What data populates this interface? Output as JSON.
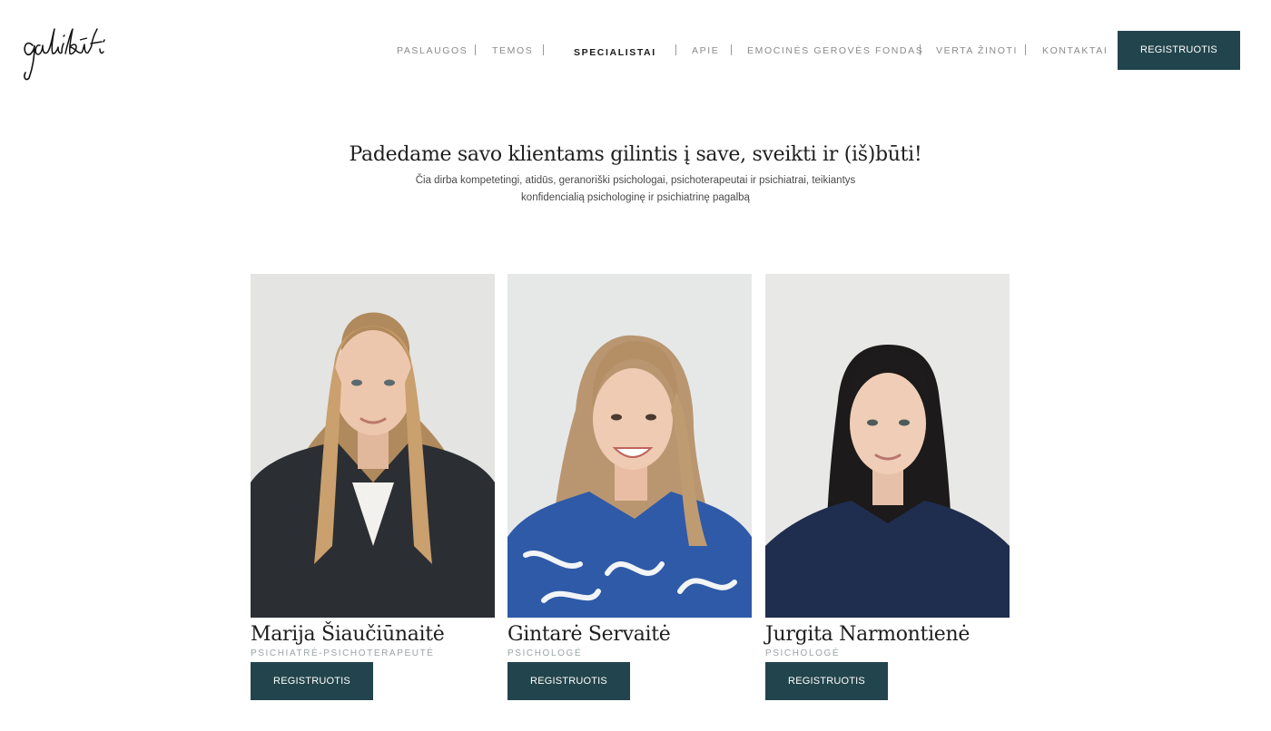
{
  "brand": {
    "logo_text": "galibūti"
  },
  "nav": {
    "items": [
      {
        "label": "PASLAUGOS"
      },
      {
        "label": "TEMOS"
      },
      {
        "label": "SPECIALISTAI"
      },
      {
        "label": "APIE"
      },
      {
        "label": "EMOCINĖS GEROVĖS FONDAS"
      },
      {
        "label": "VERTA ŽINOTI"
      },
      {
        "label": "KONTAKTAI"
      }
    ],
    "active": "SPECIALISTAI",
    "register_label": "REGISTRUOTIS"
  },
  "hero": {
    "title": "Padedame savo klientams gilintis į save, sveikti ir (iš)būti!",
    "subtitle": "Čia dirba kompetetingi, atidūs, geranoriški psichologai, psichoterapeutai ir psichiatrai, teikiantys konfidencialią psichologinę ir psichiatrinę pagalbą"
  },
  "specialists": [
    {
      "name": "Marija Šiaučiūnaitė",
      "role": "PSICHIATRĖ-PSICHOTERAPEUTĖ",
      "button": "REGISTRUOTIS"
    },
    {
      "name": "Gintarė Servaitė",
      "role": "PSICHOLOGĖ",
      "button": "REGISTRUOTIS"
    },
    {
      "name": "Jurgita Narmontienė",
      "role": "PSICHOLOGĖ",
      "button": "REGISTRUOTIS"
    }
  ],
  "colors": {
    "accent": "#22444c",
    "muted": "#9aa4a6"
  }
}
